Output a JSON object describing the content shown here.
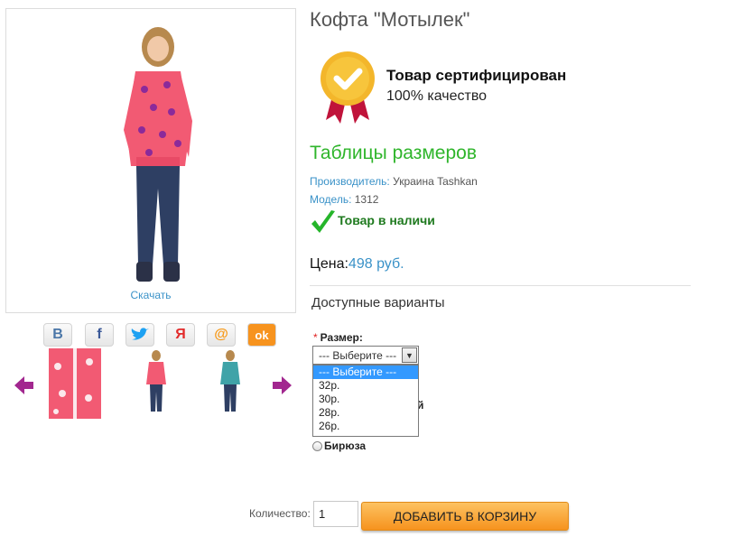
{
  "product": {
    "title": "Кофта \"Мотылек\"",
    "download_label": "Скачать"
  },
  "certificate": {
    "title": "Товар сертифицирован",
    "subtitle": "100% качество"
  },
  "sizes_table_title": "Таблицы размеров",
  "manufacturer": {
    "label": "Производитель:",
    "value": "Украина Tashkan"
  },
  "model": {
    "label": "Модель:",
    "value": "1312"
  },
  "stock_status": "Товар в наличи",
  "price": {
    "label": "Цена:",
    "value": "498 руб."
  },
  "variants_title": "Доступные варианты",
  "size_option": {
    "required_mark": "*",
    "label": "Размер:",
    "selected": "--- Выберите ---",
    "options": [
      "--- Выберите ---",
      "32р.",
      "30р.",
      "28р.",
      "26р."
    ]
  },
  "color_option": {
    "hidden_peek": "й",
    "radio_label": "Бирюза"
  },
  "social": [
    {
      "icon": "vk-icon",
      "glyph": "B",
      "color": "#4a76a8"
    },
    {
      "icon": "facebook-icon",
      "glyph": "f",
      "color": "#3b5998"
    },
    {
      "icon": "twitter-icon",
      "glyph": "t",
      "color": "#1da1f2"
    },
    {
      "icon": "moi-mir-icon",
      "glyph": "Я",
      "color": "#e22b2b"
    },
    {
      "icon": "mail-ru-icon",
      "glyph": "@",
      "color": "#f79a1a"
    },
    {
      "icon": "odnoklassniki-icon",
      "glyph": "ok",
      "color": "#f7931e"
    }
  ],
  "quantity": {
    "label": "Количество:",
    "value": "1"
  },
  "add_to_cart_label": "ДОБАВИТЬ В КОРЗИНУ",
  "colors": {
    "accent_blue": "#3a92c8",
    "green": "#2fb52b",
    "button_orange": "#f6931e"
  }
}
